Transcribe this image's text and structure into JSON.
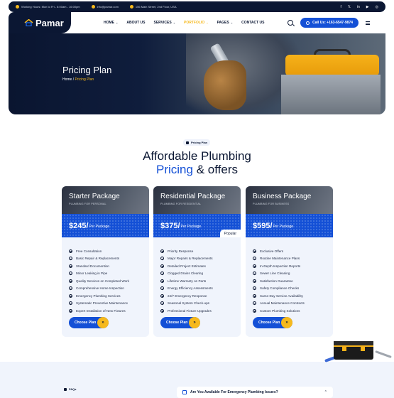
{
  "topbar": {
    "hours": "Working Hours: Mon to Fri - 8:00am - 16:00pm",
    "email": "info@pamar.com",
    "address": "156 Main Street, 2nd Floor, USA",
    "social_icons": [
      "facebook-icon",
      "x-icon",
      "linkedin-icon",
      "youtube-icon",
      "instagram-icon"
    ]
  },
  "nav": {
    "logo": "Pamar",
    "items": [
      {
        "label": "HOME"
      },
      {
        "label": "ABOUT US"
      },
      {
        "label": "SERVICES"
      },
      {
        "label": "PORTFOLIO"
      },
      {
        "label": "PAGES"
      },
      {
        "label": "CONTACT US"
      }
    ],
    "call": "Call Us: +163-6547-9874"
  },
  "hero": {
    "title": "Pricing Plan",
    "crumb_home": "Home",
    "crumb_sep": "/",
    "crumb_current": "Pricing Plan"
  },
  "section": {
    "tag": "Pricing Plan",
    "heading_line1": "Affordable Plumbing",
    "heading_blue": "Pricing",
    "heading_rest": "& offers"
  },
  "plans": [
    {
      "title": "Starter Package",
      "subtitle": "PLUMBING FOR PERSONAL",
      "price": "$245/",
      "per": "Per Package",
      "features": [
        "Free Consultation",
        "Basic Repair & Replacements",
        "Standard Documention",
        "Minor Leaking in Pipe",
        "Quality Services on Completed Work",
        "Comprehensive Home Inspection",
        "Emergency Plumbing Services",
        "Systematic Preventive Maintenance",
        "Expert Installation of New Fixtures"
      ],
      "cta": "Choose Plan"
    },
    {
      "title": "Residential Package",
      "subtitle": "PLUMBING FOR RESIDENTIAL",
      "price": "$375/",
      "per": "Per Package",
      "badge": "Popular",
      "features": [
        "Priority Response",
        "Major Repairs & Replacements",
        "Detailed Project Estimates",
        "Clogged Drains Clearing",
        "Lifetime Warranty on Parts",
        "Energy Efficiency Assessments",
        "24/7 Emergency Response",
        "Seasonal System Check-ups",
        "Professional Fixture Upgrades"
      ],
      "cta": "Choose Plan"
    },
    {
      "title": "Business Package",
      "subtitle": "PLUMBING FOR BUSINESS",
      "price": "$595/",
      "per": "Per Package",
      "features": [
        "Exclusive Offers",
        "Routine Maintenance Plans",
        "In-Depth Inspection Reports",
        "Sewer Line Cleaning",
        "Satisfaction Guarantee",
        "Safety Compliance Checks",
        "Same-Day Service Availability",
        "Annual Maintenance Contracts",
        "Custom Plumbing Solutions"
      ],
      "cta": "Choose Plan"
    }
  ],
  "faq": {
    "tag": "FAQs",
    "question": "Are You Available For Emergency Plumbing Issues?"
  },
  "colors": {
    "navy": "#0b1733",
    "blue": "#1450d6",
    "yellow": "#f6b91d",
    "card_bg": "#f0f4fc"
  }
}
